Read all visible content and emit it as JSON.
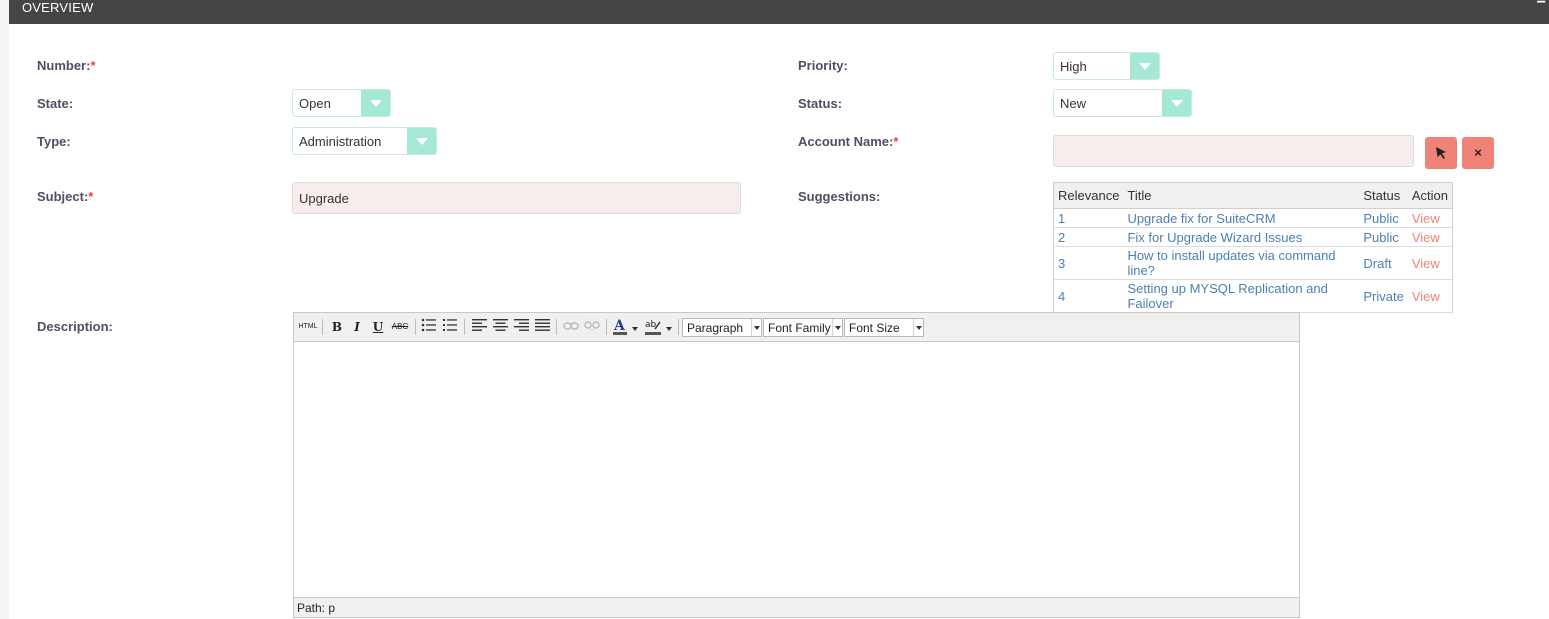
{
  "panel": {
    "title": "OVERVIEW",
    "collapse_symbol": "−"
  },
  "form": {
    "number": {
      "label": "Number:",
      "required": "*"
    },
    "state": {
      "label": "State:",
      "value": "Open"
    },
    "type": {
      "label": "Type:",
      "value": "Administration"
    },
    "subject": {
      "label": "Subject:",
      "required": "*",
      "value": "Upgrade"
    },
    "description": {
      "label": "Description:"
    },
    "priority": {
      "label": "Priority:",
      "value": "High"
    },
    "status": {
      "label": "Status:",
      "value": "New"
    },
    "account_name": {
      "label": "Account Name:",
      "required": "*",
      "value": "",
      "select_icon": "cursor-icon",
      "clear_icon": "close-icon",
      "clear_symbol": "×"
    },
    "suggestions": {
      "label": "Suggestions:"
    }
  },
  "suggestions_table": {
    "headers": [
      "Relevance",
      "Title",
      "Status",
      "Action"
    ],
    "rows": [
      {
        "relevance": "1",
        "title": "Upgrade fix for SuiteCRM",
        "status": "Public",
        "action": "View"
      },
      {
        "relevance": "2",
        "title": "Fix for Upgrade Wizard Issues",
        "status": "Public",
        "action": "View"
      },
      {
        "relevance": "3",
        "title": "How to install updates via command line?",
        "status": "Draft",
        "action": "View"
      },
      {
        "relevance": "4",
        "title": "Setting up MYSQL Replication and Failover",
        "status": "Private",
        "action": "View"
      }
    ]
  },
  "editor": {
    "toolbar": {
      "html": "HTML",
      "bold": "B",
      "italic": "I",
      "underline": "U",
      "strike": "ABC",
      "format": "Paragraph",
      "font_family": "Font Family",
      "font_size": "Font Size"
    },
    "path": "Path: p"
  },
  "colors": {
    "header_bg": "#454545",
    "select_arrow": "#a5e8d6",
    "required": "#e0463b",
    "link": "#4d7fb0",
    "action": "#f08377"
  }
}
